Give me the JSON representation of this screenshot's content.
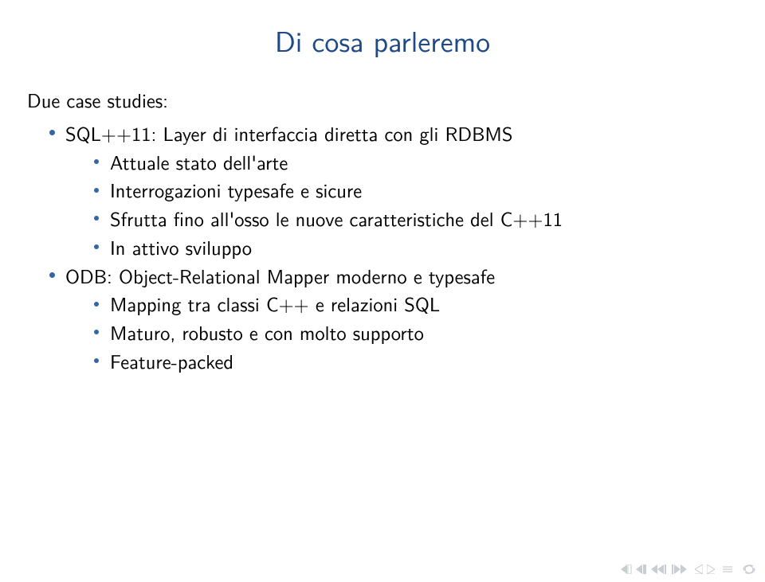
{
  "title": "Di cosa parleremo",
  "intro": "Due case studies:",
  "items": [
    {
      "label": "SQL++11: Layer di interfaccia diretta con gli RDBMS",
      "sub": [
        "Attuale stato dell'arte",
        "Interrogazioni typesafe e sicure",
        "Sfrutta fino all'osso le nuove caratteristiche del C++11",
        "In attivo sviluppo"
      ]
    },
    {
      "label": "ODB: Object-Relational Mapper moderno e typesafe",
      "sub": [
        "Mapping tra classi C++ e relazioni SQL",
        "Maturo, robusto e con molto supporto",
        "Feature-packed"
      ]
    }
  ]
}
